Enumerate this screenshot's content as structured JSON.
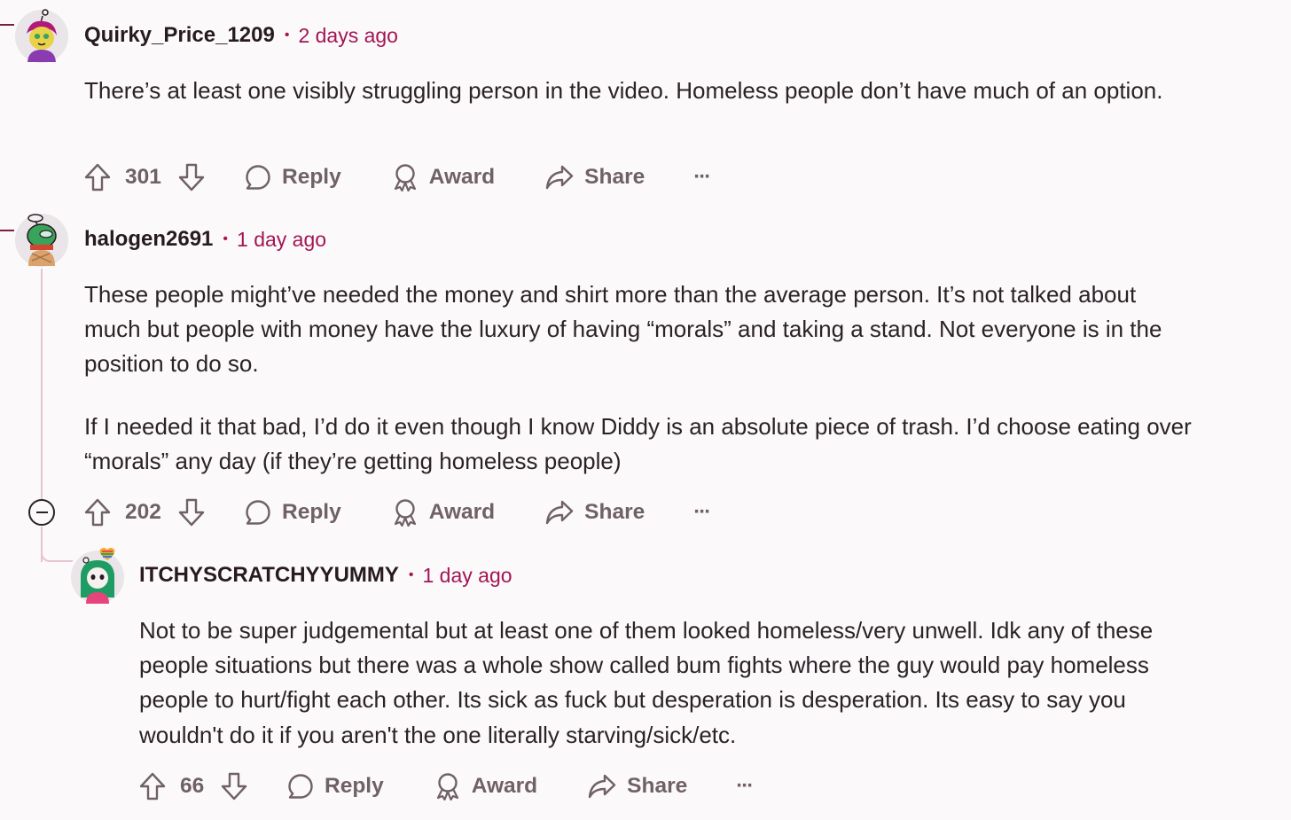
{
  "comments": [
    {
      "username": "Quirky_Price_1209",
      "separator": "•",
      "time": "2 days ago",
      "paragraphs": [
        "There’s at least one visibly struggling person in the video. Homeless people don’t have much of an option."
      ],
      "score": "301",
      "reply_label": "Reply",
      "award_label": "Award",
      "share_label": "Share",
      "more_label": "···"
    },
    {
      "username": "halogen2691",
      "separator": "•",
      "time": "1 day ago",
      "paragraphs": [
        "These people might’ve needed the money and shirt more than the average person. It’s not talked about much but people with money have the luxury of having “morals” and taking a stand. Not everyone is in the position to do so.",
        "If I needed it that bad, I’d do it even though I know Diddy is an absolute piece of trash. I’d choose eating over “morals” any day (if they’re getting homeless people)"
      ],
      "score": "202",
      "reply_label": "Reply",
      "award_label": "Award",
      "share_label": "Share",
      "more_label": "···"
    },
    {
      "username": "ITCHYSCRATCHYYUMMY",
      "separator": "•",
      "time": "1 day ago",
      "paragraphs": [
        "Not to be super judgemental but at least one of them looked homeless/very unwell. Idk any of these people situations but there was a whole show called bum fights where the guy would pay homeless people to hurt/fight each other. Its sick as fuck but desperation is desperation. Its easy to say you wouldn't do it if you aren't the one literally starving/sick/etc."
      ],
      "score": "66",
      "reply_label": "Reply",
      "award_label": "Award",
      "share_label": "Share",
      "more_label": "···"
    }
  ],
  "icons": {
    "upvote": "arrow-up-icon",
    "downvote": "arrow-down-icon",
    "reply": "speech-bubble-icon",
    "award": "award-ribbon-icon",
    "share": "share-arrow-icon",
    "more": "ellipsis-icon",
    "collapse": "minus-circle-icon"
  },
  "colors": {
    "background": "#fcf9fa",
    "timestamp": "#a31555",
    "action_text": "#6f6167",
    "thread_line": "#e6c3d2"
  }
}
